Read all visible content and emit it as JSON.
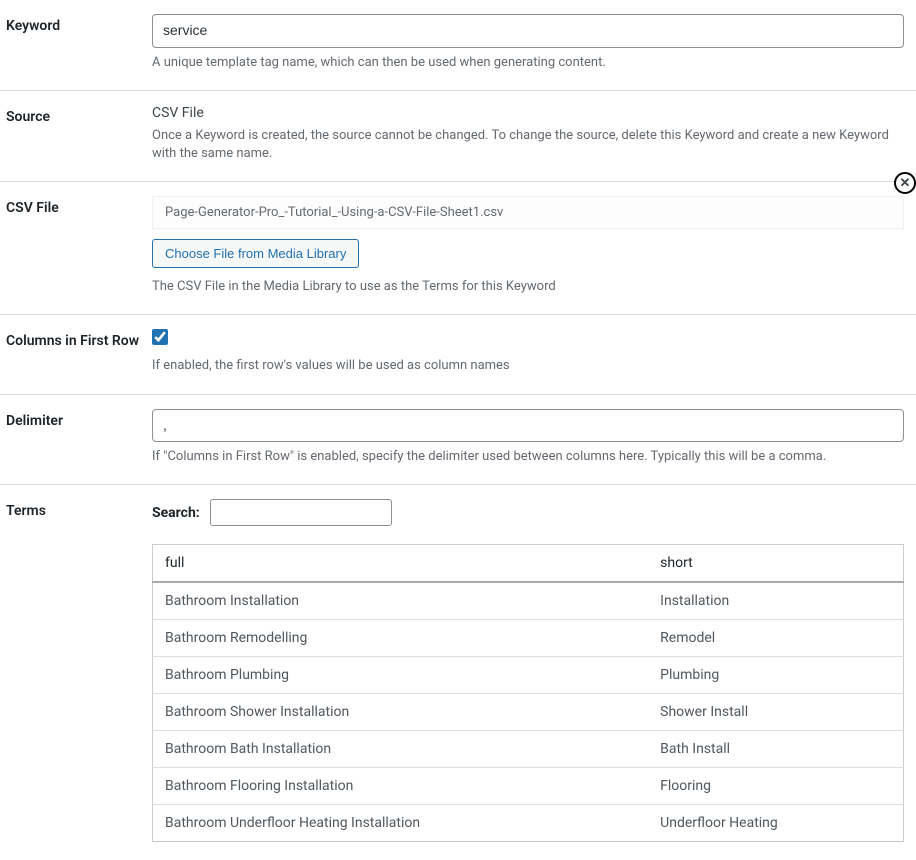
{
  "keyword": {
    "label": "Keyword",
    "value": "service",
    "description": "A unique template tag name, which can then be used when generating content."
  },
  "source": {
    "label": "Source",
    "value": "CSV File",
    "description": "Once a Keyword is created, the source cannot be changed. To change the source, delete this Keyword and create a new Keyword with the same name."
  },
  "csvFile": {
    "label": "CSV File",
    "filename": "Page-Generator-Pro_-Tutorial_-Using-a-CSV-File-Sheet1.csv",
    "buttonLabel": "Choose File from Media Library",
    "description": "The CSV File in the Media Library to use as the Terms for this Keyword"
  },
  "columnsFirstRow": {
    "label": "Columns in First Row",
    "checked": true,
    "description": "If enabled, the first row's values will be used as column names"
  },
  "delimiter": {
    "label": "Delimiter",
    "value": ",",
    "description": "If \"Columns in First Row\" is enabled, specify the delimiter used between columns here. Typically this will be a comma."
  },
  "terms": {
    "label": "Terms",
    "searchLabel": "Search:",
    "searchValue": "",
    "headers": {
      "full": "full",
      "short": "short"
    },
    "rows": [
      {
        "full": "Bathroom Installation",
        "short": "Installation"
      },
      {
        "full": "Bathroom Remodelling",
        "short": "Remodel"
      },
      {
        "full": "Bathroom Plumbing",
        "short": "Plumbing"
      },
      {
        "full": "Bathroom Shower Installation",
        "short": "Shower Install"
      },
      {
        "full": "Bathroom Bath Installation",
        "short": "Bath Install"
      },
      {
        "full": "Bathroom Flooring Installation",
        "short": "Flooring"
      },
      {
        "full": "Bathroom Underfloor Heating Installation",
        "short": "Underfloor Heating"
      }
    ]
  }
}
